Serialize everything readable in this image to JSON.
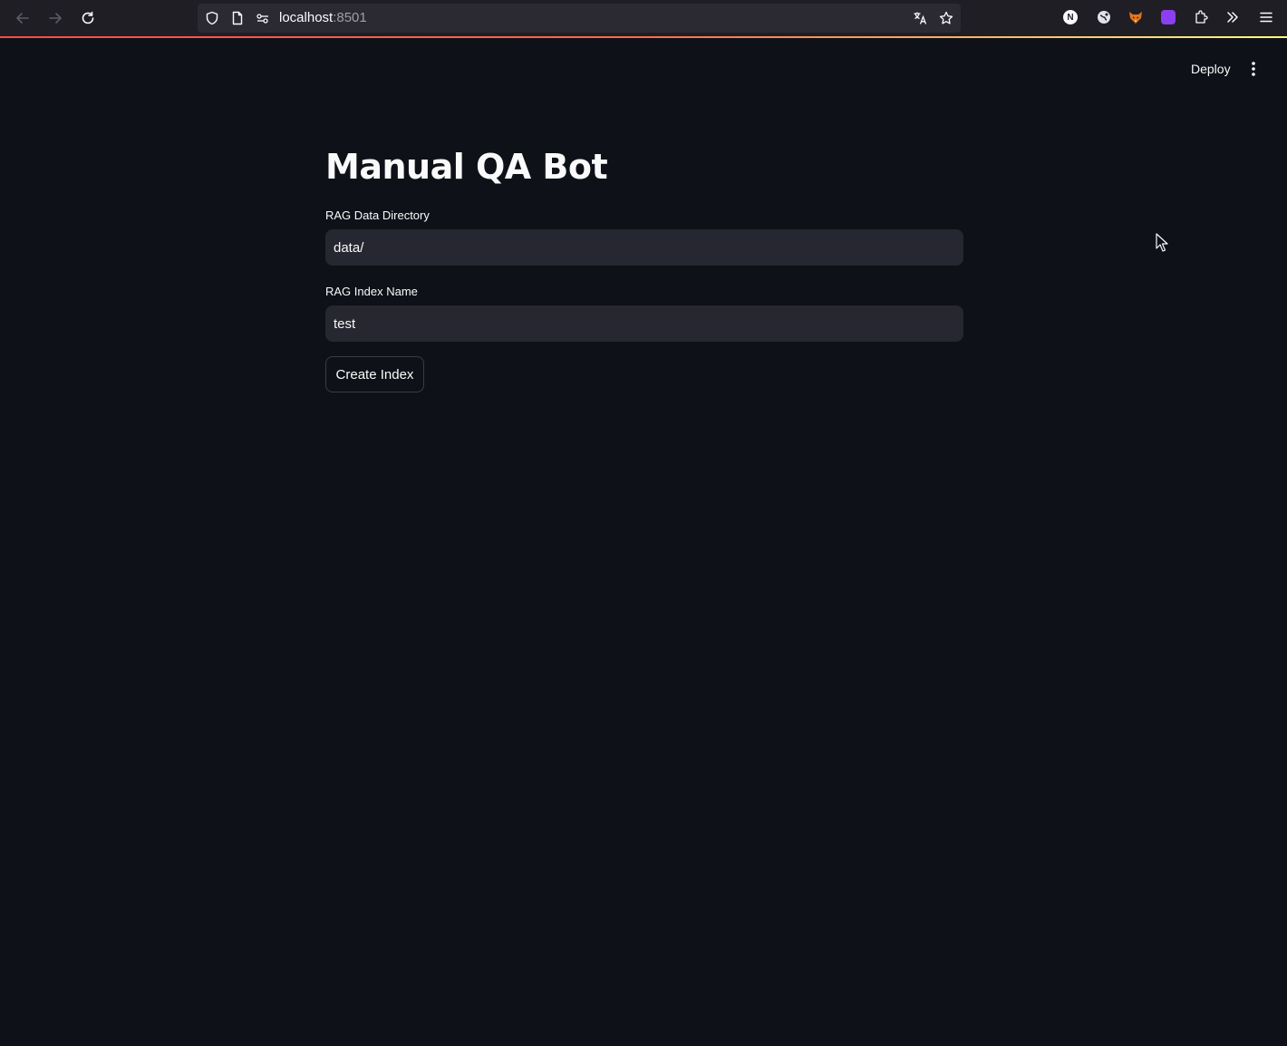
{
  "browser": {
    "url_host": "localhost",
    "url_port": ":8501",
    "icons": {
      "back": "arrow-left-icon",
      "forward": "arrow-right-icon",
      "reload": "reload-icon",
      "tracking_protection": "shield-icon",
      "page_info": "page-icon",
      "permissions": "permissions-icon",
      "translate": "translate-icon",
      "bookmark": "star-icon",
      "extensions": "puzzle-icon",
      "overflow": "chevrons-right-icon",
      "menu": "hamburger-menu-icon"
    },
    "extension_n_letter": "N"
  },
  "header": {
    "deploy_label": "Deploy",
    "menu_icon": "vertical-dots-icon"
  },
  "main": {
    "title": "Manual QA Bot",
    "data_dir": {
      "label": "RAG Data Directory",
      "value": "data/"
    },
    "index_name": {
      "label": "RAG Index Name",
      "value": "test"
    },
    "create_button_label": "Create Index"
  },
  "colors": {
    "background": "#0e1117",
    "input_background": "#262730",
    "text": "#fafafa",
    "accent_red": "#ff4b4b",
    "accent_yellow": "#fffd80"
  }
}
